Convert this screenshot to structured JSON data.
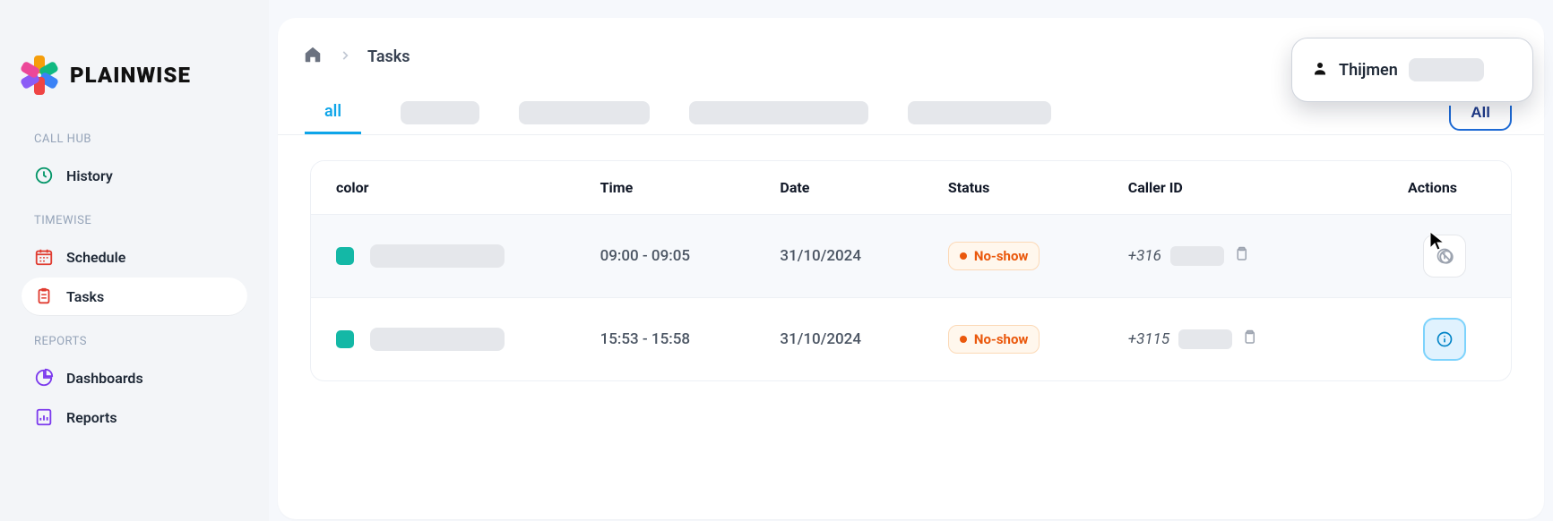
{
  "brand": {
    "name": "PLAINWISE"
  },
  "sidebar": {
    "sections": {
      "callhub": {
        "label": "CALL HUB",
        "items": [
          {
            "label": "History"
          }
        ]
      },
      "timewise": {
        "label": "TIMEWISE",
        "items": [
          {
            "label": "Schedule"
          },
          {
            "label": "Tasks"
          }
        ]
      },
      "reports": {
        "label": "REPORTS",
        "items": [
          {
            "label": "Dashboards"
          },
          {
            "label": "Reports"
          }
        ]
      }
    }
  },
  "breadcrumb": {
    "current": "Tasks"
  },
  "tabs": {
    "active": "all"
  },
  "filter_button": {
    "label": "All"
  },
  "user": {
    "name": "Thijmen"
  },
  "table": {
    "headers": {
      "color": "color",
      "time": "Time",
      "date": "Date",
      "status": "Status",
      "caller": "Caller ID",
      "actions": "Actions"
    },
    "rows": [
      {
        "time": "09:00 - 09:05",
        "date": "31/10/2024",
        "status": "No-show",
        "caller_prefix": "+316"
      },
      {
        "time": "15:53 - 15:58",
        "date": "31/10/2024",
        "status": "No-show",
        "caller_prefix": "+3115"
      }
    ]
  }
}
